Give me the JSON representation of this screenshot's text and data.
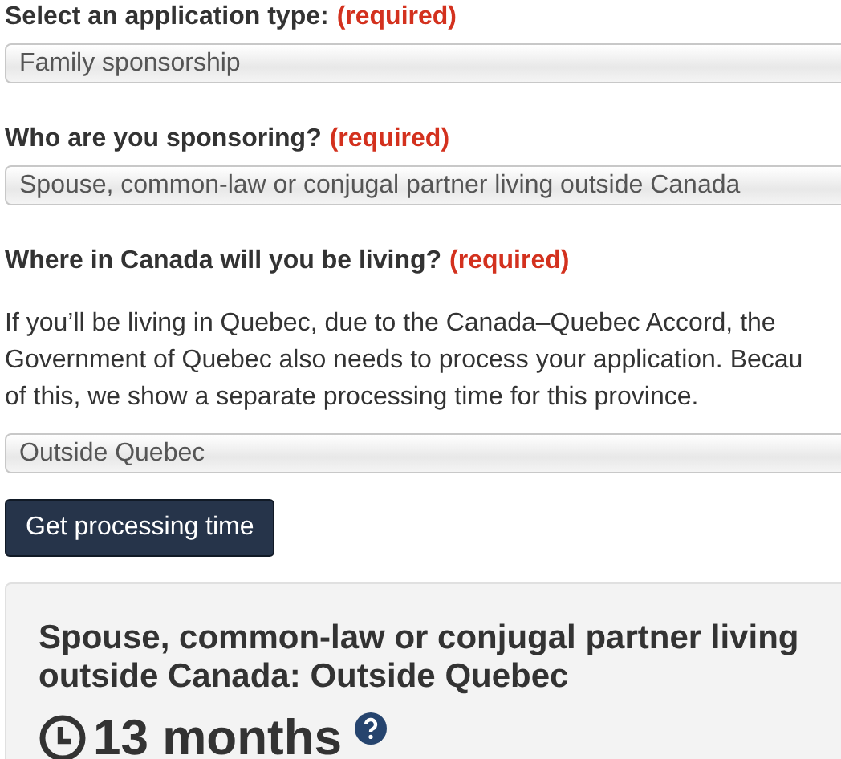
{
  "fields": [
    {
      "label": "Select an application type:",
      "required_note": "(required)",
      "value": "Family sponsorship"
    },
    {
      "label": "Who are you sponsoring?",
      "required_note": "(required)",
      "value": "Spouse, common-law or conjugal partner living outside Canada"
    },
    {
      "label": "Where in Canada will you be living?",
      "required_note": "(required)",
      "help_lines": [
        "If you’ll be living in Quebec, due to the Canada–Quebec Accord, the",
        "Government of Quebec also needs to process your application. Becau",
        "of this, we show a separate processing time for this province."
      ],
      "value": "Outside Quebec"
    }
  ],
  "submit_button": "Get processing time",
  "result": {
    "title_lines": [
      "Spouse, common-law or conjugal partner living",
      "outside Canada: Outside Quebec"
    ],
    "time": "13 months"
  }
}
